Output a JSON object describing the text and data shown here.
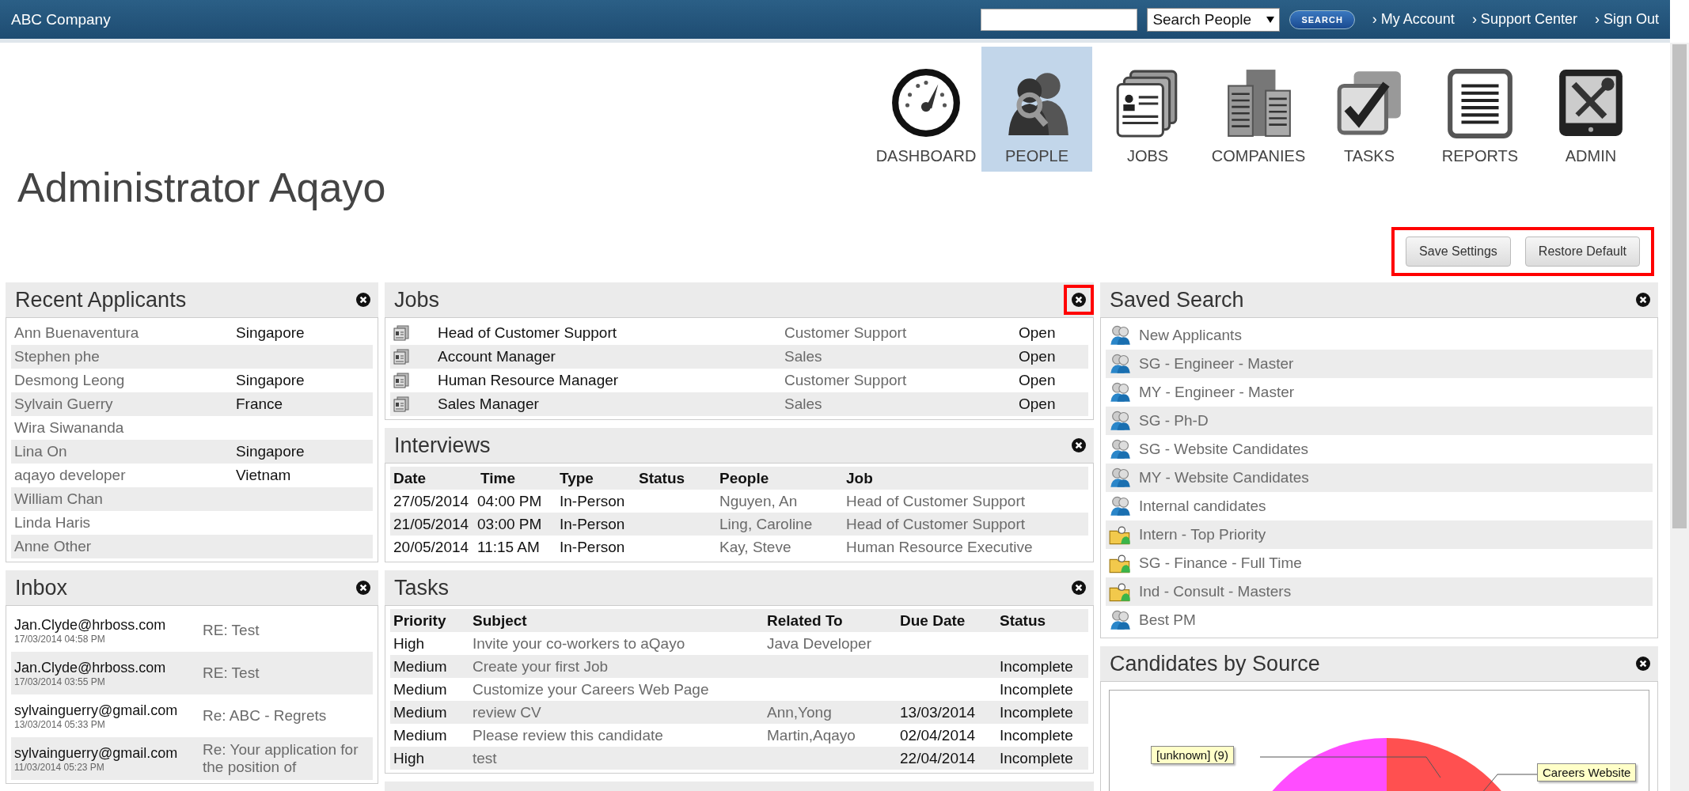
{
  "top_bar": {
    "brand": "ABC Company",
    "search_type": "Search People",
    "search_button": "SEARCH",
    "links": [
      "› My Account",
      "› Support Center",
      "› Sign Out"
    ]
  },
  "nav": [
    {
      "label": "DASHBOARD",
      "kind": "dashboard",
      "selected": false
    },
    {
      "label": "PEOPLE",
      "kind": "people",
      "selected": true
    },
    {
      "label": "JOBS",
      "kind": "jobs",
      "selected": false
    },
    {
      "label": "COMPANIES",
      "kind": "companies",
      "selected": false
    },
    {
      "label": "TASKS",
      "kind": "tasks",
      "selected": false
    },
    {
      "label": "REPORTS",
      "kind": "reports",
      "selected": false
    },
    {
      "label": "ADMIN",
      "kind": "admin",
      "selected": false
    }
  ],
  "page_title": "Administrator Aqayo",
  "settings": {
    "highlighted": true,
    "buttons": [
      "Save Settings",
      "Restore Default"
    ]
  },
  "recent_applicants": {
    "title": "Recent Applicants",
    "close_highlighted": false,
    "rows": [
      {
        "name": "Ann Buenaventura",
        "country": "Singapore"
      },
      {
        "name": "Stephen phe"
      },
      {
        "name": "Desmong Leong",
        "country": "Singapore"
      },
      {
        "name": "Sylvain Guerry",
        "country": "France"
      },
      {
        "name": "Wira Siwananda"
      },
      {
        "name": "Lina On",
        "country": "Singapore"
      },
      {
        "name": "aqayo developer",
        "country": "Vietnam"
      },
      {
        "name": "William Chan"
      },
      {
        "name": "Linda Haris"
      },
      {
        "name": "Anne Other"
      }
    ]
  },
  "inbox": {
    "title": "Inbox",
    "close_highlighted": false,
    "rows": [
      {
        "from": "Jan.Clyde@hrboss.com",
        "date": "17/03/2014 04:58 PM",
        "subject": "RE: Test"
      },
      {
        "from": "Jan.Clyde@hrboss.com",
        "date": "17/03/2014 03:55 PM",
        "subject": "RE: Test"
      },
      {
        "from": "sylvainguerry@gmail.com",
        "date": "13/03/2014 05:33 PM",
        "subject": "Re: ABC - Regrets"
      },
      {
        "from": "sylvainguerry@gmail.com",
        "date": "11/03/2014 05:23 PM",
        "subject": "Re: Your application for the position of"
      }
    ]
  },
  "jobs": {
    "title": "Jobs",
    "close_highlighted": true,
    "rows": [
      {
        "title": "Head of Customer Support",
        "department": "Customer Support",
        "status": "Open"
      },
      {
        "title": "Account Manager",
        "department": "Sales",
        "status": "Open"
      },
      {
        "title": "Human Resource Manager",
        "department": "Customer Support",
        "status": "Open"
      },
      {
        "title": "Sales Manager",
        "department": "Sales",
        "status": "Open"
      }
    ]
  },
  "interviews": {
    "title": "Interviews",
    "close_highlighted": false,
    "columns": [
      "Date",
      "Time",
      "Type",
      "Status",
      "People",
      "Job"
    ],
    "rows": [
      [
        "27/05/2014",
        "04:00 PM",
        "In-Person",
        "",
        "Nguyen, An",
        "Head of Customer Support"
      ],
      [
        "21/05/2014",
        "03:00 PM",
        "In-Person",
        "",
        "Ling, Caroline",
        "Head of Customer Support"
      ],
      [
        "20/05/2014",
        "11:15 AM",
        "In-Person",
        "",
        "Kay, Steve",
        "Human Resource Executive"
      ]
    ]
  },
  "tasks": {
    "title": "Tasks",
    "close_highlighted": false,
    "columns": [
      "Priority",
      "Subject",
      "Related To",
      "Due Date",
      "Status"
    ],
    "rows": [
      [
        "High",
        "Invite your co-workers to aQayo",
        "Java Developer",
        "",
        ""
      ],
      [
        "Medium",
        "Create your first Job",
        "",
        "",
        "Incomplete"
      ],
      [
        "Medium",
        "Customize your Careers Web Page",
        "",
        "",
        "Incomplete"
      ],
      [
        "Medium",
        "review CV",
        "Ann,Yong",
        "13/03/2014",
        "Incomplete"
      ],
      [
        "Medium",
        "Please review this candidate",
        "Martin,Aqayo",
        "02/04/2014",
        "Incomplete"
      ],
      [
        "High",
        "test",
        "",
        "22/04/2014",
        "Incomplete"
      ]
    ]
  },
  "saved_search": {
    "title": "Saved Search",
    "close_highlighted": false,
    "items": [
      {
        "label": "New Applicants",
        "kind": "group"
      },
      {
        "label": "SG - Engineer - Master",
        "kind": "group"
      },
      {
        "label": "MY - Engineer - Master",
        "kind": "group"
      },
      {
        "label": "SG - Ph-D",
        "kind": "group"
      },
      {
        "label": "SG - Website Candidates",
        "kind": "group"
      },
      {
        "label": "MY - Website Candidates",
        "kind": "group"
      },
      {
        "label": "Internal candidates",
        "kind": "group"
      },
      {
        "label": "Intern - Top Priority",
        "kind": "folder"
      },
      {
        "label": "SG - Finance - Full Time",
        "kind": "folder"
      },
      {
        "label": "Ind - Consult - Masters",
        "kind": "folder"
      },
      {
        "label": "Best PM",
        "kind": "group"
      }
    ]
  },
  "candidates_by_source": {
    "title": "Candidates by Source",
    "close_highlighted": false,
    "callouts": [
      "[unknown] (9)",
      "Careers Website"
    ]
  }
}
